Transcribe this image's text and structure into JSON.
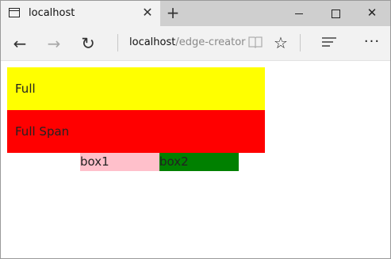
{
  "browser": {
    "tab": {
      "title": "localhost",
      "close_glyph": "✕",
      "icon": "tab-page-icon"
    },
    "new_tab_glyph": "+",
    "window_controls": {
      "minimize_icon": "minimize-icon",
      "maximize_icon": "maximize-icon",
      "close_glyph": "✕"
    },
    "toolbar": {
      "back_glyph": "←",
      "forward_glyph": "→",
      "refresh_glyph": "↻",
      "address_host": "localhost",
      "address_path": "/edge-creator",
      "favorite_glyph": "☆",
      "more_glyph": "···"
    }
  },
  "page": {
    "full_label": "Full",
    "full_span_label": "Full Span",
    "box1_label": "box1",
    "box2_label": "box2",
    "colors": {
      "full": "#ffff00",
      "full_span": "#ff0000",
      "box1": "#ffc0cb",
      "box2": "#008000"
    }
  }
}
